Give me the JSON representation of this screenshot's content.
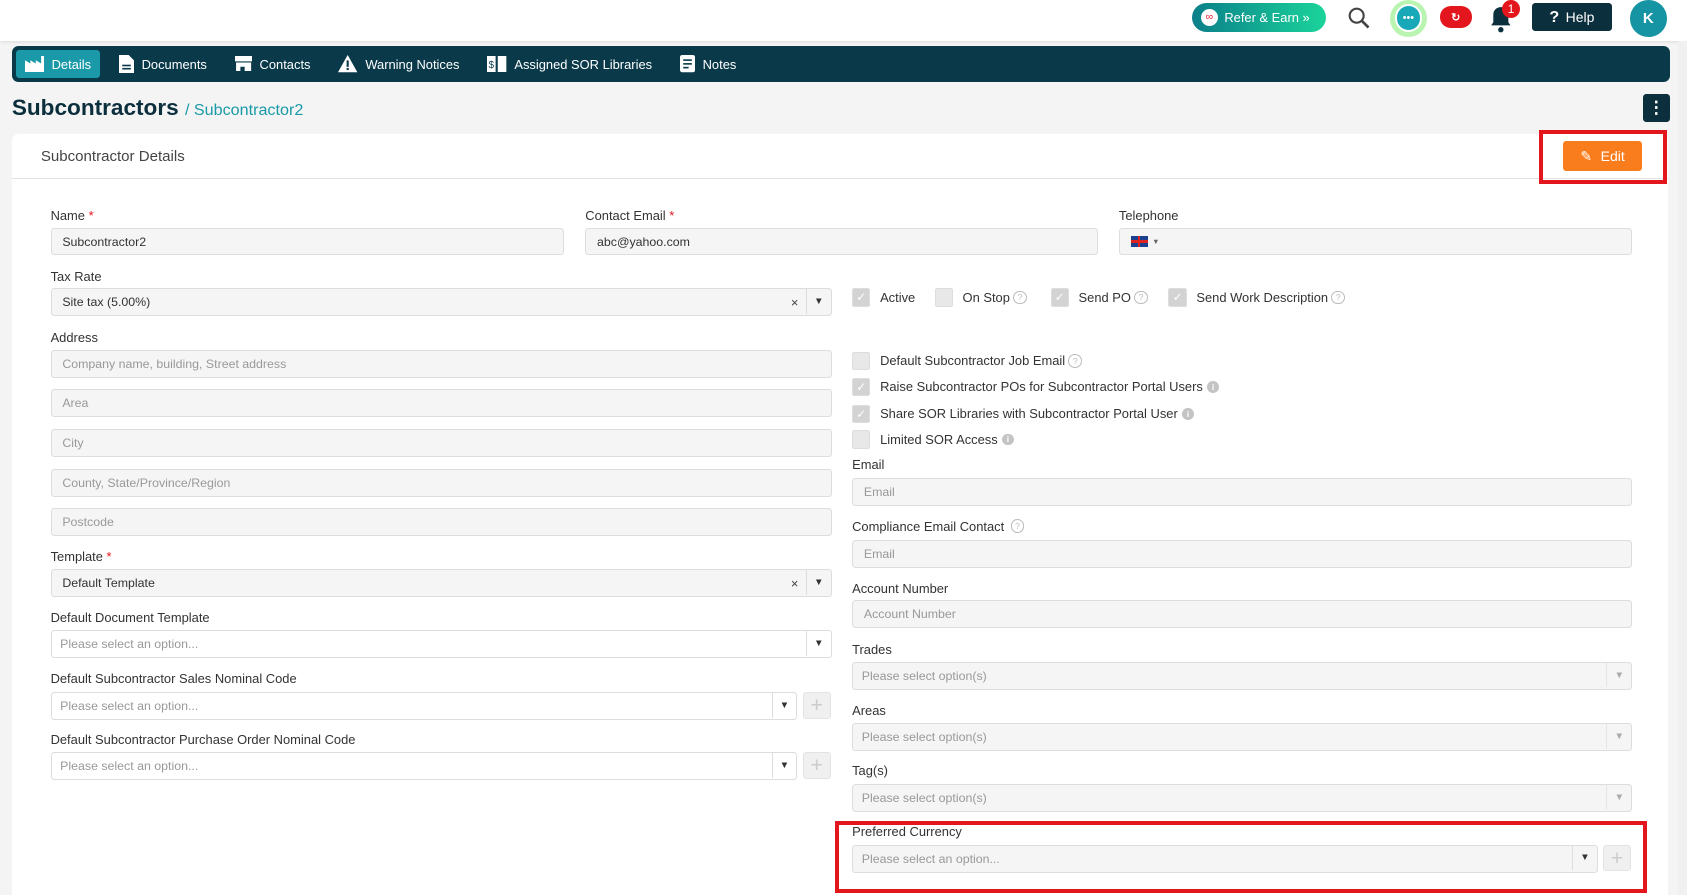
{
  "topbar": {
    "refer_label": "Refer & Earn »",
    "help_label": "Help",
    "avatar_initial": "K",
    "notification_count": "1",
    "icons": [
      "refer-logo-icon",
      "search-icon",
      "chat-icon",
      "cloud-sync-icon",
      "bell-icon",
      "question-icon"
    ]
  },
  "nav": {
    "tabs": [
      {
        "label": "Details",
        "icon": "factory-icon",
        "active": true
      },
      {
        "label": "Documents",
        "icon": "document-icon"
      },
      {
        "label": "Contacts",
        "icon": "store-icon"
      },
      {
        "label": "Warning Notices",
        "icon": "warning-icon"
      },
      {
        "label": "Assigned SOR Libraries",
        "icon": "library-icon"
      },
      {
        "label": "Notes",
        "icon": "notes-icon"
      }
    ]
  },
  "header": {
    "title": "Subcontractors",
    "breadcrumb": "/ Subcontractor2"
  },
  "card": {
    "title": "Subcontractor Details",
    "edit_label": "Edit"
  },
  "form": {
    "name": {
      "label": "Name",
      "value": "Subcontractor2"
    },
    "contact_email": {
      "label": "Contact Email",
      "value": "abc@yahoo.com"
    },
    "telephone": {
      "label": "Telephone",
      "value": ""
    },
    "tax_rate": {
      "label": "Tax Rate",
      "value": "Site tax (5.00%)"
    },
    "address": {
      "label": "Address",
      "placeholders": [
        "Company name, building, Street address",
        "Area",
        "City",
        "County, State/Province/Region",
        "Postcode"
      ]
    },
    "template": {
      "label": "Template",
      "value": "Default Template"
    },
    "default_document_template": {
      "label": "Default Document Template",
      "placeholder": "Please select an option..."
    },
    "sales_nominal": {
      "label": "Default Subcontractor Sales Nominal Code",
      "placeholder": "Please select an option..."
    },
    "po_nominal": {
      "label": "Default Subcontractor Purchase Order Nominal Code",
      "placeholder": "Please select an option..."
    },
    "flags": [
      {
        "label": "Active",
        "checked": true
      },
      {
        "label": "On Stop",
        "checked": false
      },
      {
        "label": "Send PO",
        "checked": true
      },
      {
        "label": "Send Work Description",
        "checked": true
      }
    ],
    "options": [
      {
        "label": "Default Subcontractor Job Email",
        "checked": false
      },
      {
        "label": "Raise Subcontractor POs for Subcontractor Portal Users",
        "checked": true
      },
      {
        "label": "Share SOR Libraries with Subcontractor Portal User",
        "checked": true
      },
      {
        "label": "Limited SOR Access",
        "checked": false
      }
    ],
    "email": {
      "label": "Email",
      "placeholder": "Email"
    },
    "compliance_email": {
      "label": "Compliance Email Contact",
      "placeholder": "Email"
    },
    "account_number": {
      "label": "Account Number",
      "placeholder": "Account Number"
    },
    "trades": {
      "label": "Trades",
      "placeholder": "Please select option(s)"
    },
    "areas": {
      "label": "Areas",
      "placeholder": "Please select option(s)"
    },
    "tags": {
      "label": "Tag(s)",
      "placeholder": "Please select option(s)"
    },
    "preferred_currency": {
      "label": "Preferred Currency",
      "placeholder": "Please select an option..."
    }
  },
  "colors": {
    "nav_bg": "#0a3a4a",
    "accent": "#1a9aa8",
    "edit": "#fa7d1d",
    "highlight": "#e4161d"
  }
}
